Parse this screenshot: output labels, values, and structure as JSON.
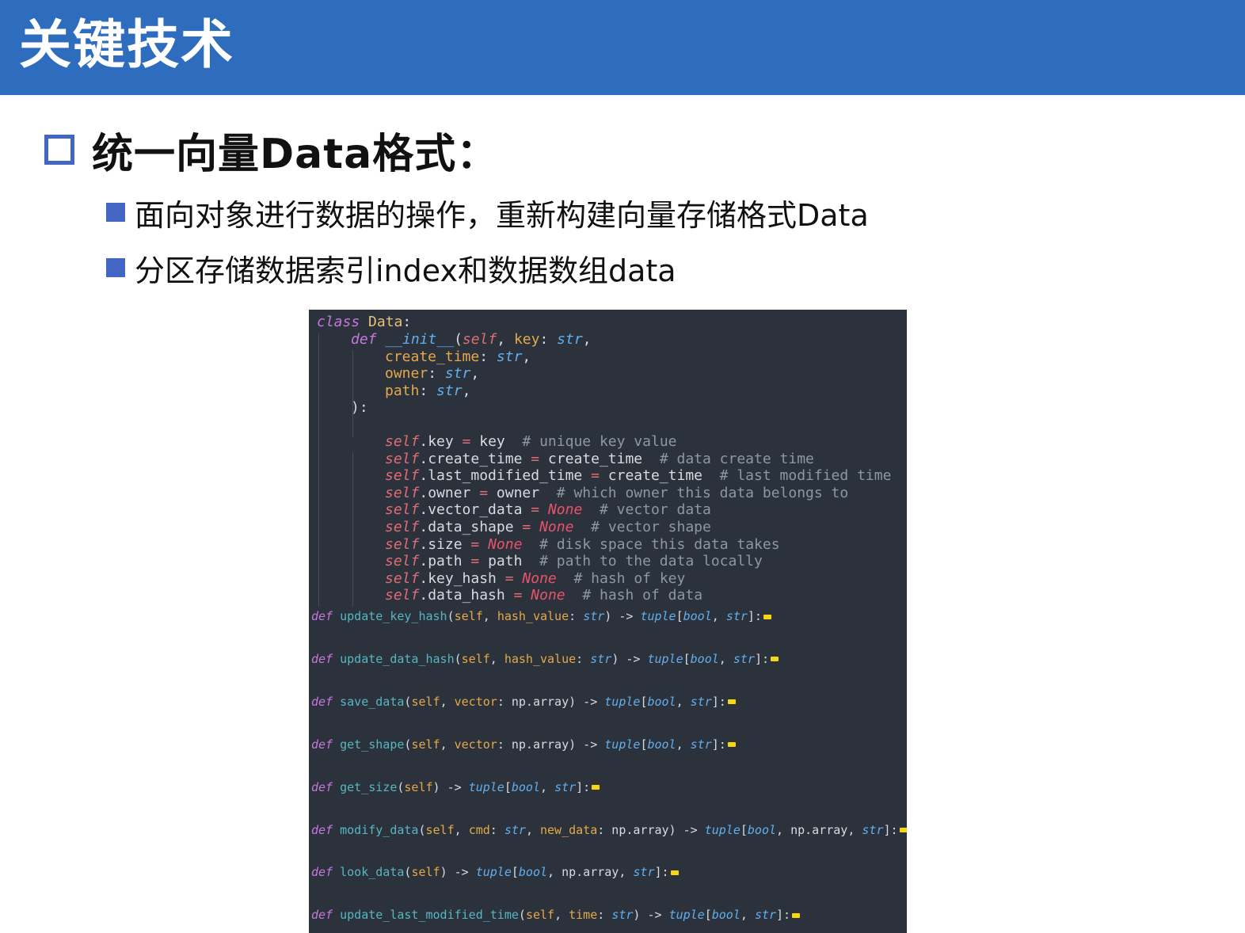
{
  "title": "关键技术",
  "heading": "统一向量Data格式：",
  "bullets": [
    "面向对象进行数据的操作，重新构建向量存储格式Data",
    "分区存储数据索引index和数据数组data"
  ],
  "code": {
    "class_keyword": "class",
    "class_name": "Data",
    "init": {
      "def": "def",
      "name": "__init__",
      "params": [
        {
          "name": "key",
          "type": "str"
        },
        {
          "name": "create_time",
          "type": "str"
        },
        {
          "name": "owner",
          "type": "str"
        },
        {
          "name": "path",
          "type": "str"
        }
      ]
    },
    "assignments": [
      {
        "attr": "key",
        "value": "key",
        "comment": "# unique key value"
      },
      {
        "attr": "create_time",
        "value": "create_time",
        "comment": "# data create time"
      },
      {
        "attr": "last_modified_time",
        "value": "create_time",
        "comment": "# last modified time"
      },
      {
        "attr": "owner",
        "value": "owner",
        "comment": "# which owner this data belongs to"
      },
      {
        "attr": "vector_data",
        "value": "None",
        "comment": "# vector data"
      },
      {
        "attr": "data_shape",
        "value": "None",
        "comment": "# vector shape"
      },
      {
        "attr": "size",
        "value": "None",
        "comment": "# disk space this data takes"
      },
      {
        "attr": "path",
        "value": "path",
        "comment": "# path to the data locally"
      },
      {
        "attr": "key_hash",
        "value": "None",
        "comment": "# hash of key"
      },
      {
        "attr": "data_hash",
        "value": "None",
        "comment": "# hash of data"
      }
    ],
    "methods": [
      {
        "name": "update_key_hash",
        "params": [
          {
            "name": "hash_value",
            "type": "str"
          }
        ],
        "returns": [
          "bool",
          "str"
        ]
      },
      {
        "name": "update_data_hash",
        "params": [
          {
            "name": "hash_value",
            "type": "str"
          }
        ],
        "returns": [
          "bool",
          "str"
        ]
      },
      {
        "name": "save_data",
        "params": [
          {
            "name": "vector",
            "type": "np.array"
          }
        ],
        "returns": [
          "bool",
          "str"
        ]
      },
      {
        "name": "get_shape",
        "params": [
          {
            "name": "vector",
            "type": "np.array"
          }
        ],
        "returns": [
          "bool",
          "str"
        ]
      },
      {
        "name": "get_size",
        "params": [],
        "returns": [
          "bool",
          "str"
        ]
      },
      {
        "name": "modify_data",
        "params": [
          {
            "name": "cmd",
            "type": "str"
          },
          {
            "name": "new_data",
            "type": "np.array"
          }
        ],
        "returns": [
          "bool",
          "np.array",
          "str"
        ]
      },
      {
        "name": "look_data",
        "params": [],
        "returns": [
          "bool",
          "np.array",
          "str"
        ]
      },
      {
        "name": "update_last_modified_time",
        "params": [
          {
            "name": "time",
            "type": "str"
          }
        ],
        "returns": [
          "bool",
          "str"
        ]
      }
    ]
  }
}
